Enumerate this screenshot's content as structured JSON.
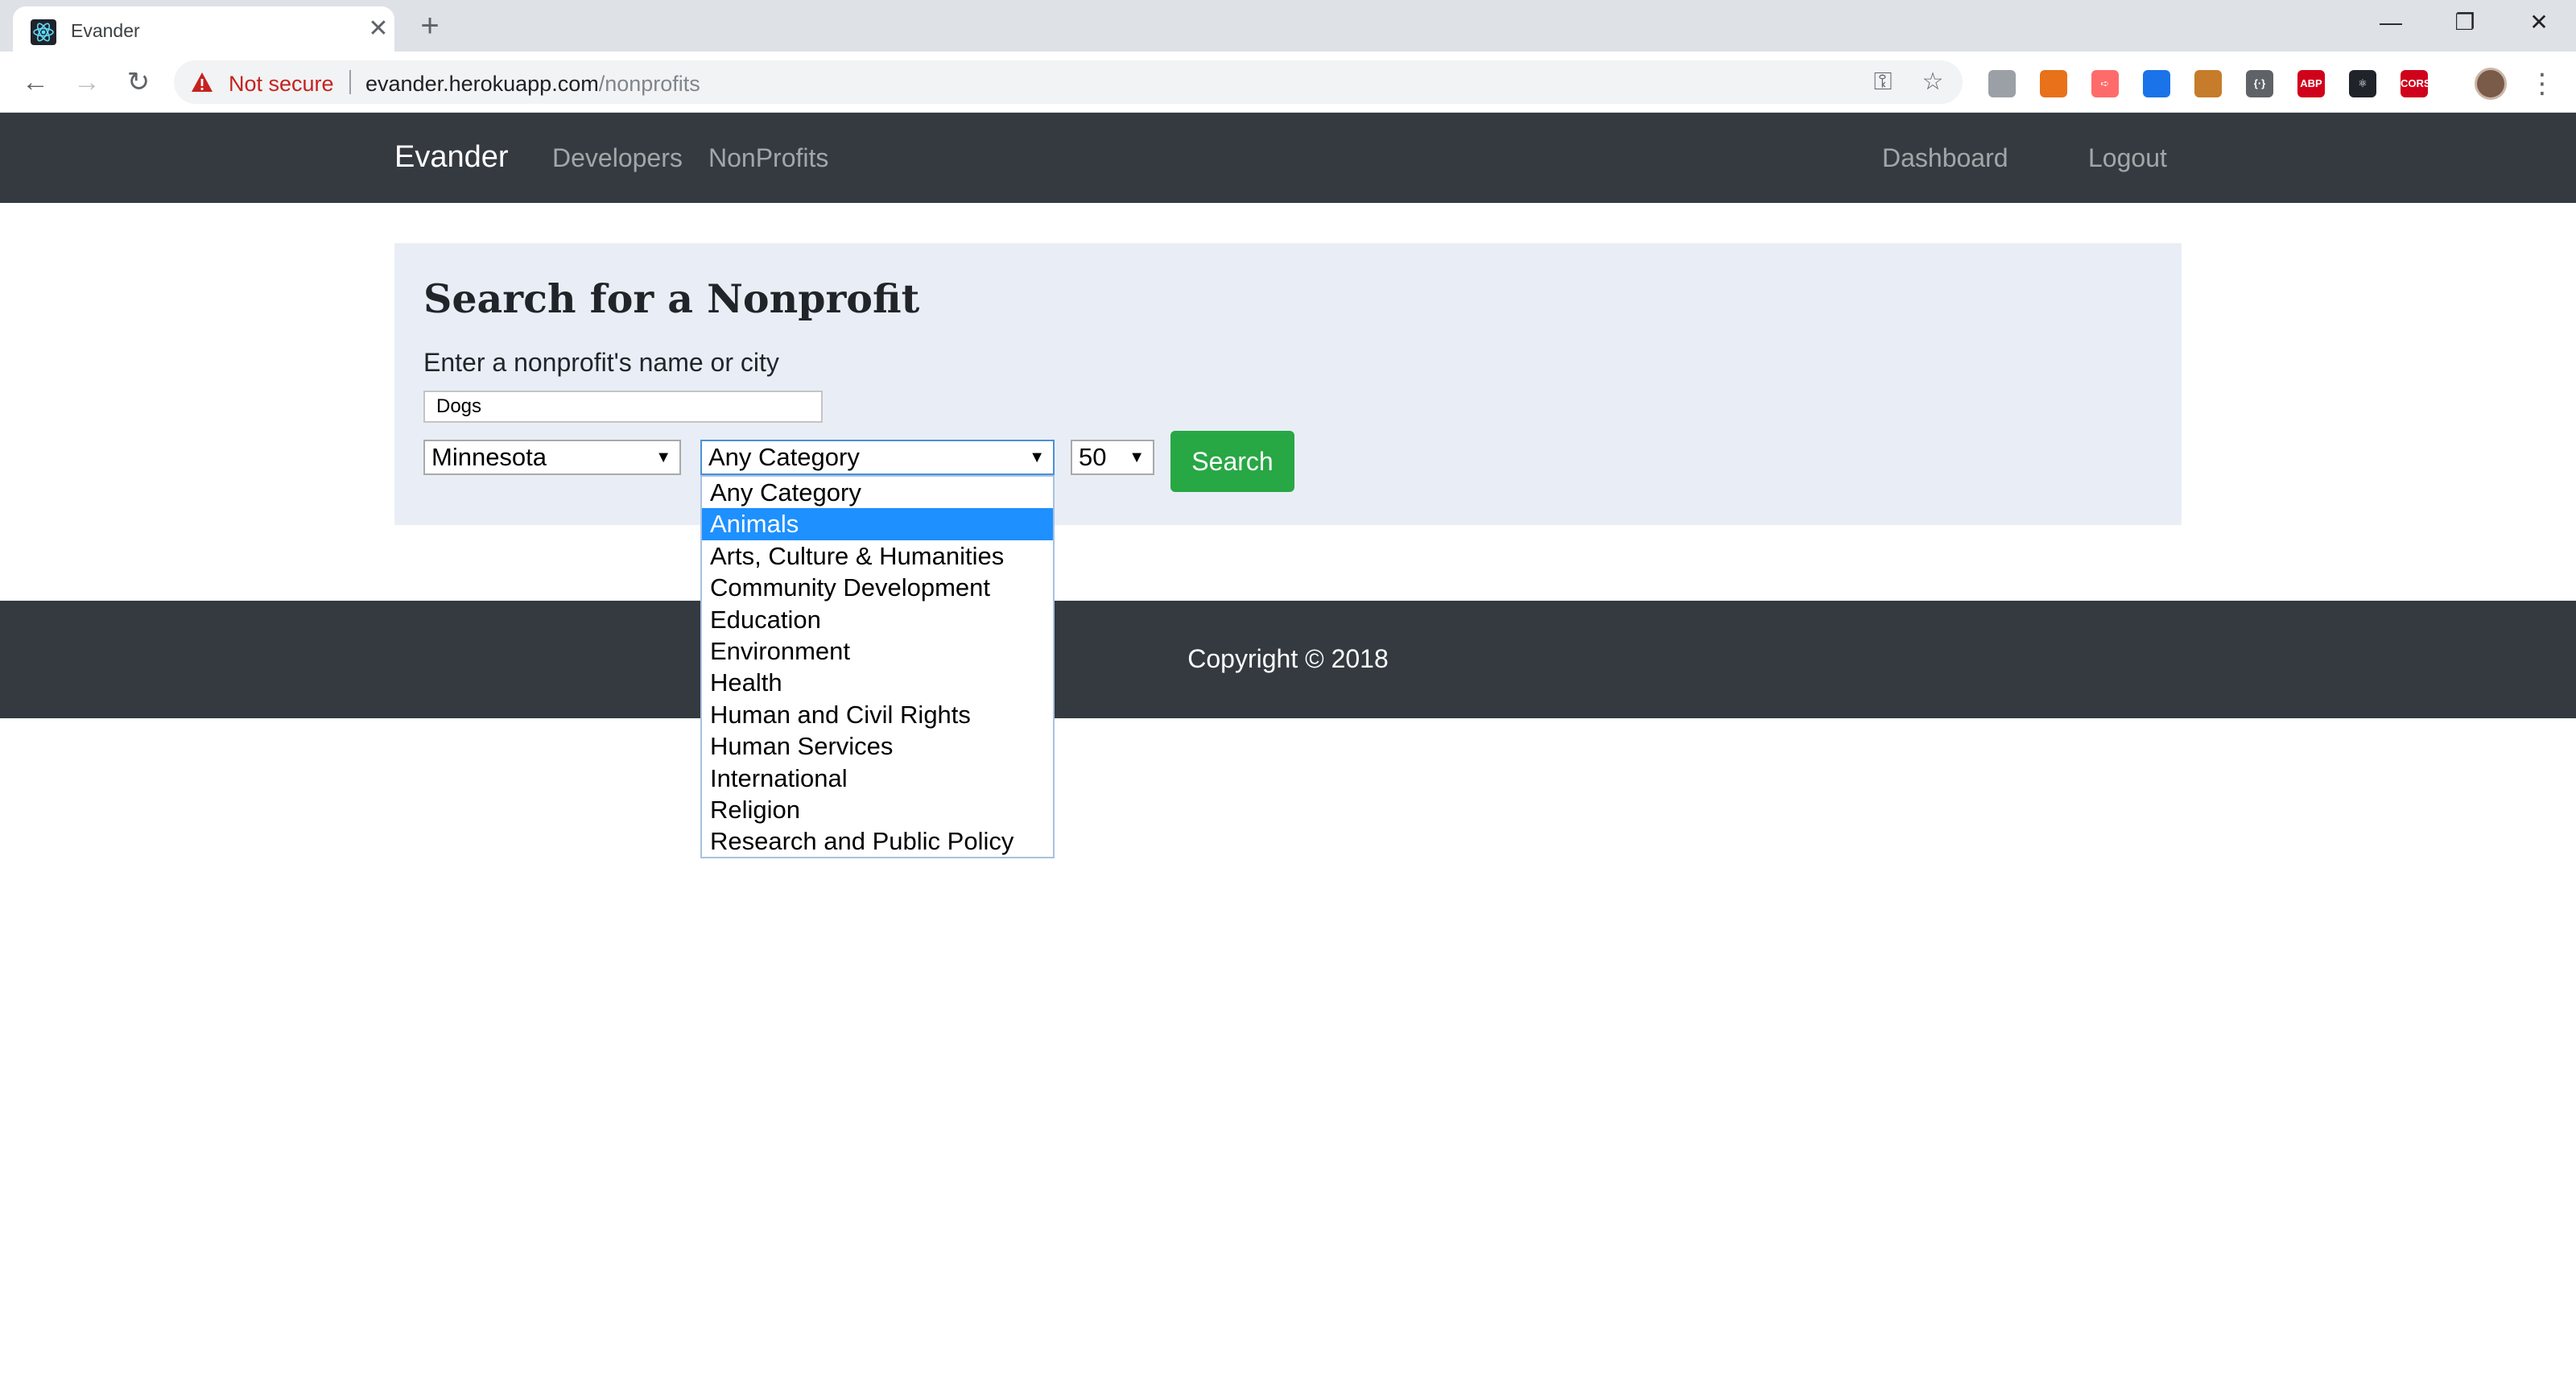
{
  "browser": {
    "tab_title": "Evander",
    "tab_close": "✕",
    "new_tab": "+",
    "window_minimize": "—",
    "window_restore": "❐",
    "window_close": "✕",
    "back": "←",
    "forward": "→",
    "reload": "↻",
    "security_label": "Not secure",
    "url_host": "evander.herokuapp.com",
    "url_path": "/nonprofits",
    "key_icon": "⚿",
    "star_icon": "☆",
    "menu_icon": "⋮",
    "extensions": [
      {
        "name": "chat",
        "label": "",
        "color": "#9aa0a6"
      },
      {
        "name": "grid",
        "label": "",
        "color": "#e8711a"
      },
      {
        "name": "arrow",
        "label": "➪",
        "color": "#ff6b6b"
      },
      {
        "name": "eyedropper",
        "label": "",
        "color": "#1a73e8"
      },
      {
        "name": "ruler",
        "label": "",
        "color": "#c67c2a"
      },
      {
        "name": "json",
        "label": "{·}",
        "color": "#5f6368"
      },
      {
        "name": "abp",
        "label": "ABP",
        "color": "#d0021b"
      },
      {
        "name": "react",
        "label": "⚛",
        "color": "#20232a"
      },
      {
        "name": "cors",
        "label": "CORS",
        "color": "#d0021b"
      }
    ]
  },
  "navbar": {
    "brand": "Evander",
    "links": [
      "Developers",
      "NonProfits"
    ],
    "right_links": [
      "Dashboard",
      "Logout"
    ]
  },
  "search": {
    "title": "Search for a Nonprofit",
    "label": "Enter a nonprofit's name or city",
    "name_value": "Dogs",
    "state_value": "Minnesota",
    "category_value": "Any Category",
    "limit_value": "50",
    "button": "Search",
    "arrow": "▼"
  },
  "category_options": [
    "Any Category",
    "Animals",
    "Arts, Culture & Humanities",
    "Community Development",
    "Education",
    "Environment",
    "Health",
    "Human and Civil Rights",
    "Human Services",
    "International",
    "Religion",
    "Research and Public Policy"
  ],
  "highlighted_option": "Animals",
  "footer": {
    "copyright": "Copyright © 2018"
  },
  "colors": {
    "navbar_bg": "#343a40",
    "jumbotron_bg": "#e9eef6",
    "search_button": "#28a745",
    "option_highlight": "#1e90ff"
  }
}
